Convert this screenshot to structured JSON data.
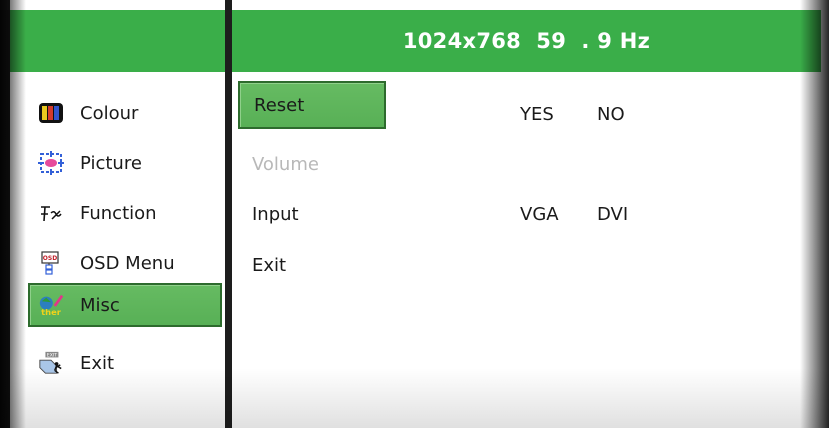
{
  "header": {
    "resolution": "1024x768  59  . 9 Hz"
  },
  "menu": {
    "items": [
      {
        "label": "Colour",
        "icon": "colour-bars-icon"
      },
      {
        "label": "Picture",
        "icon": "picture-icon"
      },
      {
        "label": "Function",
        "icon": "function-icon"
      },
      {
        "label": "OSD Menu",
        "icon": "osd-menu-icon"
      },
      {
        "label": "Misc",
        "icon": "misc-icon",
        "selected": true
      },
      {
        "label": "Exit",
        "icon": "exit-icon"
      }
    ]
  },
  "misc": {
    "options": [
      {
        "label": "Reset",
        "selected": true,
        "values": [
          "YES",
          "NO"
        ]
      },
      {
        "label": "Volume",
        "disabled": true,
        "values": []
      },
      {
        "label": "Input",
        "values": [
          "VGA",
          "DVI"
        ]
      },
      {
        "label": "Exit",
        "values": []
      }
    ]
  },
  "colors": {
    "header_green": "#3aae49",
    "selected_green": "#5fb45c",
    "disabled_text": "#b8b8b8"
  }
}
